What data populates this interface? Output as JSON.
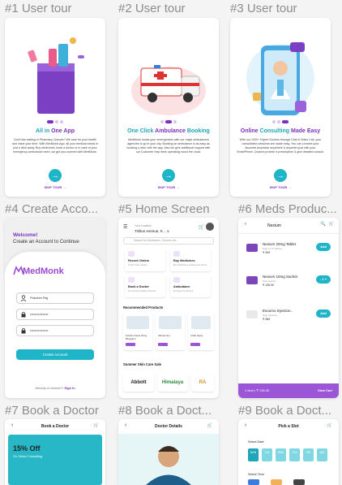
{
  "frames": {
    "f1": "#1 User tour",
    "f2": "#2 User tour",
    "f3": "#3 User tour",
    "f4": "#4 Create Acco...",
    "f5": "#5 Home Screen",
    "f6": "#6 Meds Produc...",
    "f7": "#7 Book a Doctor",
    "f8": "#8 Book a Doct...",
    "f9": "#9 Book a Doct..."
  },
  "tour1": {
    "title_a": "All in",
    "title_b": " One App",
    "text": "Don't like waiting in Pharmacy Queues? We care for your health and value your time. With MedMonk App, all your medical needs in just a click away. Buy medicines, book a doctor or in case of your emergency ambulance need, we got you covered with MedMonk.",
    "skip": "SKIP TOUR →"
  },
  "tour2": {
    "title_a": "One Click",
    "title_b": " Ambulance",
    "title_c": " Booking",
    "text": "MedMonk books your emergencies with our major ambulances agencies to go in your city. Booking an ambulance is as easy as booking a uber with the app. Also we give additional support with our Customer help desk operating round the clock.",
    "skip": "SKIP TOUR →"
  },
  "tour3": {
    "title_a": "Online",
    "title_b": " Consulting",
    "title_c": " Made Easy",
    "text": "With our 1000+ Expert Doctors through Chat & Video Call, your consultation sessions are made easy. You can connect your favourite physician anywhere & anywhen just with your SmartPhone. Doctors provide e-prescription & give detailed consult.",
    "skip": "SKIP TOUR →"
  },
  "account": {
    "welcome": "Welcome!",
    "subtitle": "Create an Account to Continue",
    "logo": "MedMonk",
    "name": "Praveen Raj",
    "password": "••••••••••••••••",
    "confirm": "••••••••••••••••",
    "create": "Create Account",
    "member": "Already a member?",
    "signin": " Sign In"
  },
  "home": {
    "location_label": "Your Location",
    "location": "Tiriltus Avenue, K... ∨",
    "search_placeholder": "Search for Medicines, Doctors etc",
    "tiles": [
      {
        "label": "Recent Orders",
        "sub": "Track Order Status"
      },
      {
        "label": "Buy Medicines",
        "sub": "Buy Medicines at Discount Prices"
      },
      {
        "label": "Book a Doctor",
        "sub": "Our Doctors Advise Remote"
      },
      {
        "label": "Ambulance",
        "sub": "Emergency Service"
      }
    ],
    "recommended": "Recommended Products",
    "products": [
      {
        "name": "Fucidin Cream 15mg Ringwarm"
      },
      {
        "name": "Altoxan Gel"
      },
      {
        "name": "Cetlin Spray"
      }
    ],
    "summer": "Summer Skin Care Sale",
    "brands": [
      "Abbott",
      "Himalaya",
      "RA"
    ]
  },
  "meds": {
    "title": "Nexium",
    "items": [
      {
        "name": "Nexium 20mg Tablet",
        "sub": "Strip of 10 Tablets",
        "price": "₹ 205",
        "action": "Add"
      },
      {
        "name": "Nexium 10mg Sachet",
        "sub": "Strip Sachet",
        "price": "₹ 135.30",
        "action": "- 1 +"
      },
      {
        "name": "Esoomo Injection..",
        "sub": "Strip Injection",
        "price": "₹ 289",
        "action": "Add"
      }
    ],
    "cart_left": "1 Item | ₹ 135.30",
    "cart_right": "View Cart"
  },
  "book": {
    "title": "Book a Doctor",
    "offer_big": "15% Off",
    "offer_small": "On Online Consulting"
  },
  "details": {
    "title": "Doctor Details"
  },
  "slot": {
    "title": "Pick a Slot",
    "select_date": "Select Date",
    "select_time": "Select Time",
    "dates": [
      "MON",
      "TUE",
      "WED",
      "THU",
      "FRI",
      "SAT"
    ]
  },
  "colors": {
    "purple": "#7b2fbe",
    "teal": "#1fb5c9",
    "accent_purple": "#9c55d6"
  }
}
